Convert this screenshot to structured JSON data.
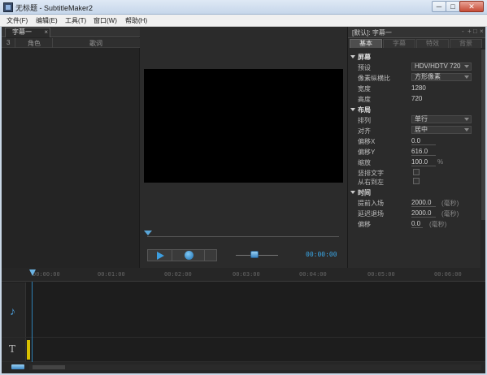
{
  "window": {
    "title": "无标题 - SubtitleMaker2",
    "controls": {
      "minimize": "─",
      "maximize": "□",
      "close": "✕"
    }
  },
  "menu": [
    "文件(F)",
    "编辑(E)",
    "工具(T)",
    "窗口(W)",
    "帮助(H)"
  ],
  "subtitle_panel": {
    "tab_label": "字幕一",
    "columns": {
      "index": "3",
      "role": "角色",
      "lyrics": "歌词"
    }
  },
  "player": {
    "time": "00:00:00",
    "volume_level": 0.45
  },
  "properties": {
    "header_title": "[默认]: 字幕一",
    "header_buttons": [
      "-",
      "+",
      "□",
      "×"
    ],
    "tabs": [
      "基本",
      "字幕",
      "特效",
      "背景"
    ],
    "active_tab": 0,
    "sections": {
      "screen": {
        "title": "屏幕",
        "preset_label": "预设",
        "preset_value": "HDV/HDTV 720",
        "aspect_label": "像素纵横比",
        "aspect_value": "方形像素",
        "width_label": "宽度",
        "width_value": "1280",
        "height_label": "高度",
        "height_value": "720"
      },
      "layout": {
        "title": "布局",
        "arrange_label": "排列",
        "arrange_value": "单行",
        "align_label": "对齐",
        "align_value": "居中",
        "offset_x_label": "偏移X",
        "offset_x_value": "0.0",
        "offset_y_label": "偏移Y",
        "offset_y_value": "616.0",
        "scale_label": "缩放",
        "scale_value": "100.0",
        "scale_unit": "%",
        "vertical_label": "竖排文字",
        "rtl_label": "从右到左"
      },
      "time": {
        "title": "时间",
        "lead_in_label": "提前入场",
        "lead_in_value": "2000.0",
        "lead_in_unit": "(毫秒)",
        "delay_out_label": "延迟退场",
        "delay_out_value": "2000.0",
        "delay_out_unit": "(毫秒)",
        "offset_label": "偏移",
        "offset_value": "0.0",
        "offset_unit": "(毫秒)"
      }
    }
  },
  "timeline": {
    "ticks": [
      "00:00:00",
      "00:01:00",
      "00:02:00",
      "00:03:00",
      "00:04:00",
      "00:05:00",
      "00:06:00"
    ],
    "audio_icon": "music-note-icon",
    "text_icon": "text-T-icon",
    "text_glyph": "T",
    "note_glyph": "♪"
  },
  "colors": {
    "accent": "#3aa8e8",
    "background": "#2b2b2b",
    "text_marker": "#d8c000"
  }
}
